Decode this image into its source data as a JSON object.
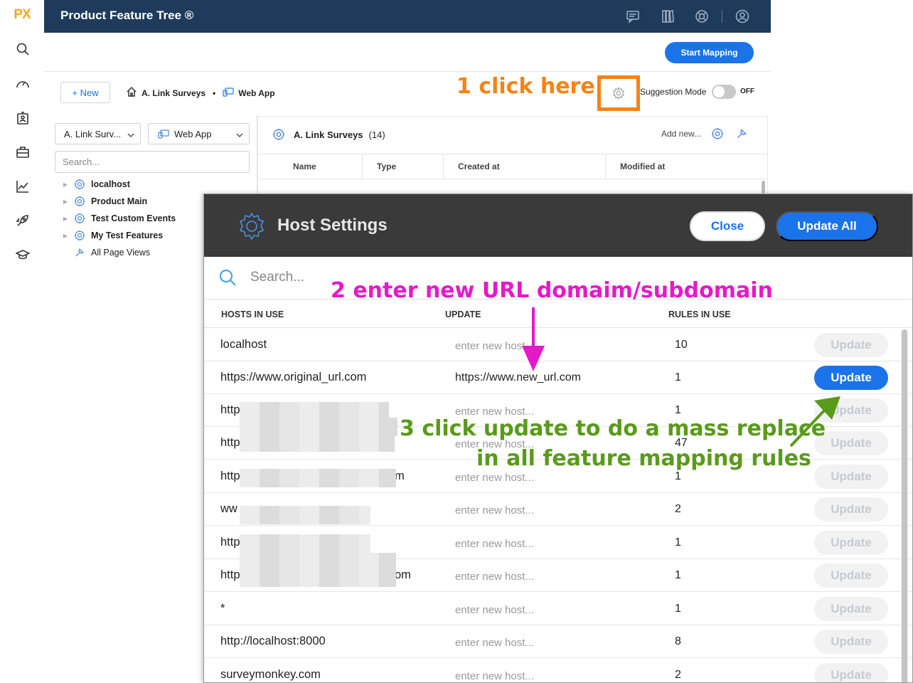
{
  "rail": {
    "logo": "PX",
    "icons": [
      "search-icon",
      "dashboard-gauge-icon",
      "badge-icon",
      "toolbox-icon",
      "analytics-icon",
      "rocket-icon",
      "graduation-cap-icon"
    ]
  },
  "header": {
    "title": "Product Feature Tree ®",
    "icons": [
      "chat-icon",
      "book-icon",
      "support-icon",
      "user-icon"
    ]
  },
  "toolbar": {
    "start_mapping": "Start Mapping",
    "new_button": "+ New",
    "breadcrumb": [
      "A. Link Surveys",
      "•",
      "Web App"
    ],
    "suggestion_label": "Suggestion Mode",
    "suggestion_state": "OFF"
  },
  "tree": {
    "app_select": "A. Link Surv...",
    "platform_select": "Web App",
    "search_placeholder": "Search...",
    "items": [
      {
        "label": "localhost"
      },
      {
        "label": "Product Main"
      },
      {
        "label": "Test Custom Events"
      },
      {
        "label": "My Test Features"
      },
      {
        "label": "All Page Views"
      }
    ]
  },
  "list": {
    "name": "A. Link Surveys",
    "count": "(14)",
    "add_new": "Add new...",
    "columns": [
      "Name",
      "Type",
      "Created at",
      "Modified at"
    ]
  },
  "modal": {
    "title": "Host Settings",
    "close": "Close",
    "update_all": "Update All",
    "search_placeholder": "Search...",
    "columns": [
      "HOSTS IN USE",
      "UPDATE",
      "RULES IN USE"
    ],
    "rows": [
      {
        "host": "localhost",
        "update": "enter new host...",
        "rules": "10",
        "button": "Update"
      },
      {
        "host": "https://www.original_url.com",
        "update": "https://www.new_url.com",
        "rules": "1",
        "button": "Update"
      },
      {
        "host": "http",
        "update": "enter new host...",
        "rules": "1",
        "button": "Update"
      },
      {
        "host": "http",
        "update": "enter new host...",
        "rules": "47",
        "button": "Update"
      },
      {
        "host": "http",
        "host_tail": "m",
        "update": "enter new host...",
        "rules": "1",
        "button": "Update"
      },
      {
        "host": "ww",
        "update": "enter new host...",
        "rules": "2",
        "button": "Update"
      },
      {
        "host": "http",
        "update": "enter new host...",
        "rules": "1",
        "button": "Update"
      },
      {
        "host": "http",
        "host_tail": "om",
        "update": "enter new host...",
        "rules": "1",
        "button": "Update"
      },
      {
        "host": "*",
        "update": "enter new host...",
        "rules": "1",
        "button": "Update"
      },
      {
        "host": "http://localhost:8000",
        "update": "enter new host...",
        "rules": "8",
        "button": "Update"
      },
      {
        "host": "surveymonkey.com",
        "update": "enter new host...",
        "rules": "2",
        "button": "Update"
      }
    ]
  },
  "annotations": {
    "step1": "1 click here",
    "step2": "2 enter new URL domaim/subdomain",
    "step3_line1": "3 click update to do a mass replace",
    "step3_line2": "in all feature mapping rules"
  },
  "colors": {
    "header_bg": "#1f3b5c",
    "accent_blue": "#1a73e8",
    "annotation_orange": "#f68314",
    "annotation_magenta": "#e619c9",
    "annotation_green": "#5a9a1a",
    "modal_header_bg": "#3a3a3a"
  }
}
